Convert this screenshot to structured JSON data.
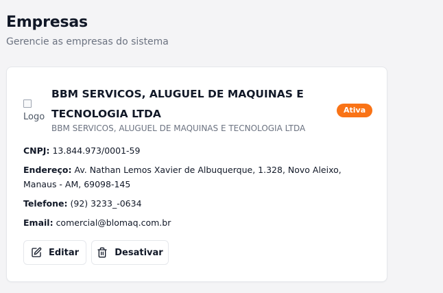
{
  "header": {
    "title": "Empresas",
    "subtitle": "Gerencie as empresas do sistema"
  },
  "company": {
    "logo_alt": "Logo",
    "name": "BBM SERVICOS, ALUGUEL DE MAQUINAS E TECNOLOGIA LTDA",
    "legal_name": "BBM SERVICOS, ALUGUEL DE MAQUINAS E TECNOLOGIA LTDA",
    "status": "Ativa",
    "status_color": "#f97316",
    "cnpj_label": "CNPJ:",
    "cnpj": "13.844.973/0001-59",
    "address_label": "Endereço:",
    "address": "Av. Nathan Lemos Xavier de Albuquerque, 1.328, Novo Aleixo, Manaus - AM, 69098-145",
    "phone_label": "Telefone:",
    "phone": "(92) 3233_-0634",
    "email_label": "Email:",
    "email": "comercial@blomaq.com.br"
  },
  "actions": {
    "edit_label": "Editar",
    "edit_icon": "edit-icon",
    "deactivate_label": "Desativar",
    "deactivate_icon": "trash-icon"
  }
}
